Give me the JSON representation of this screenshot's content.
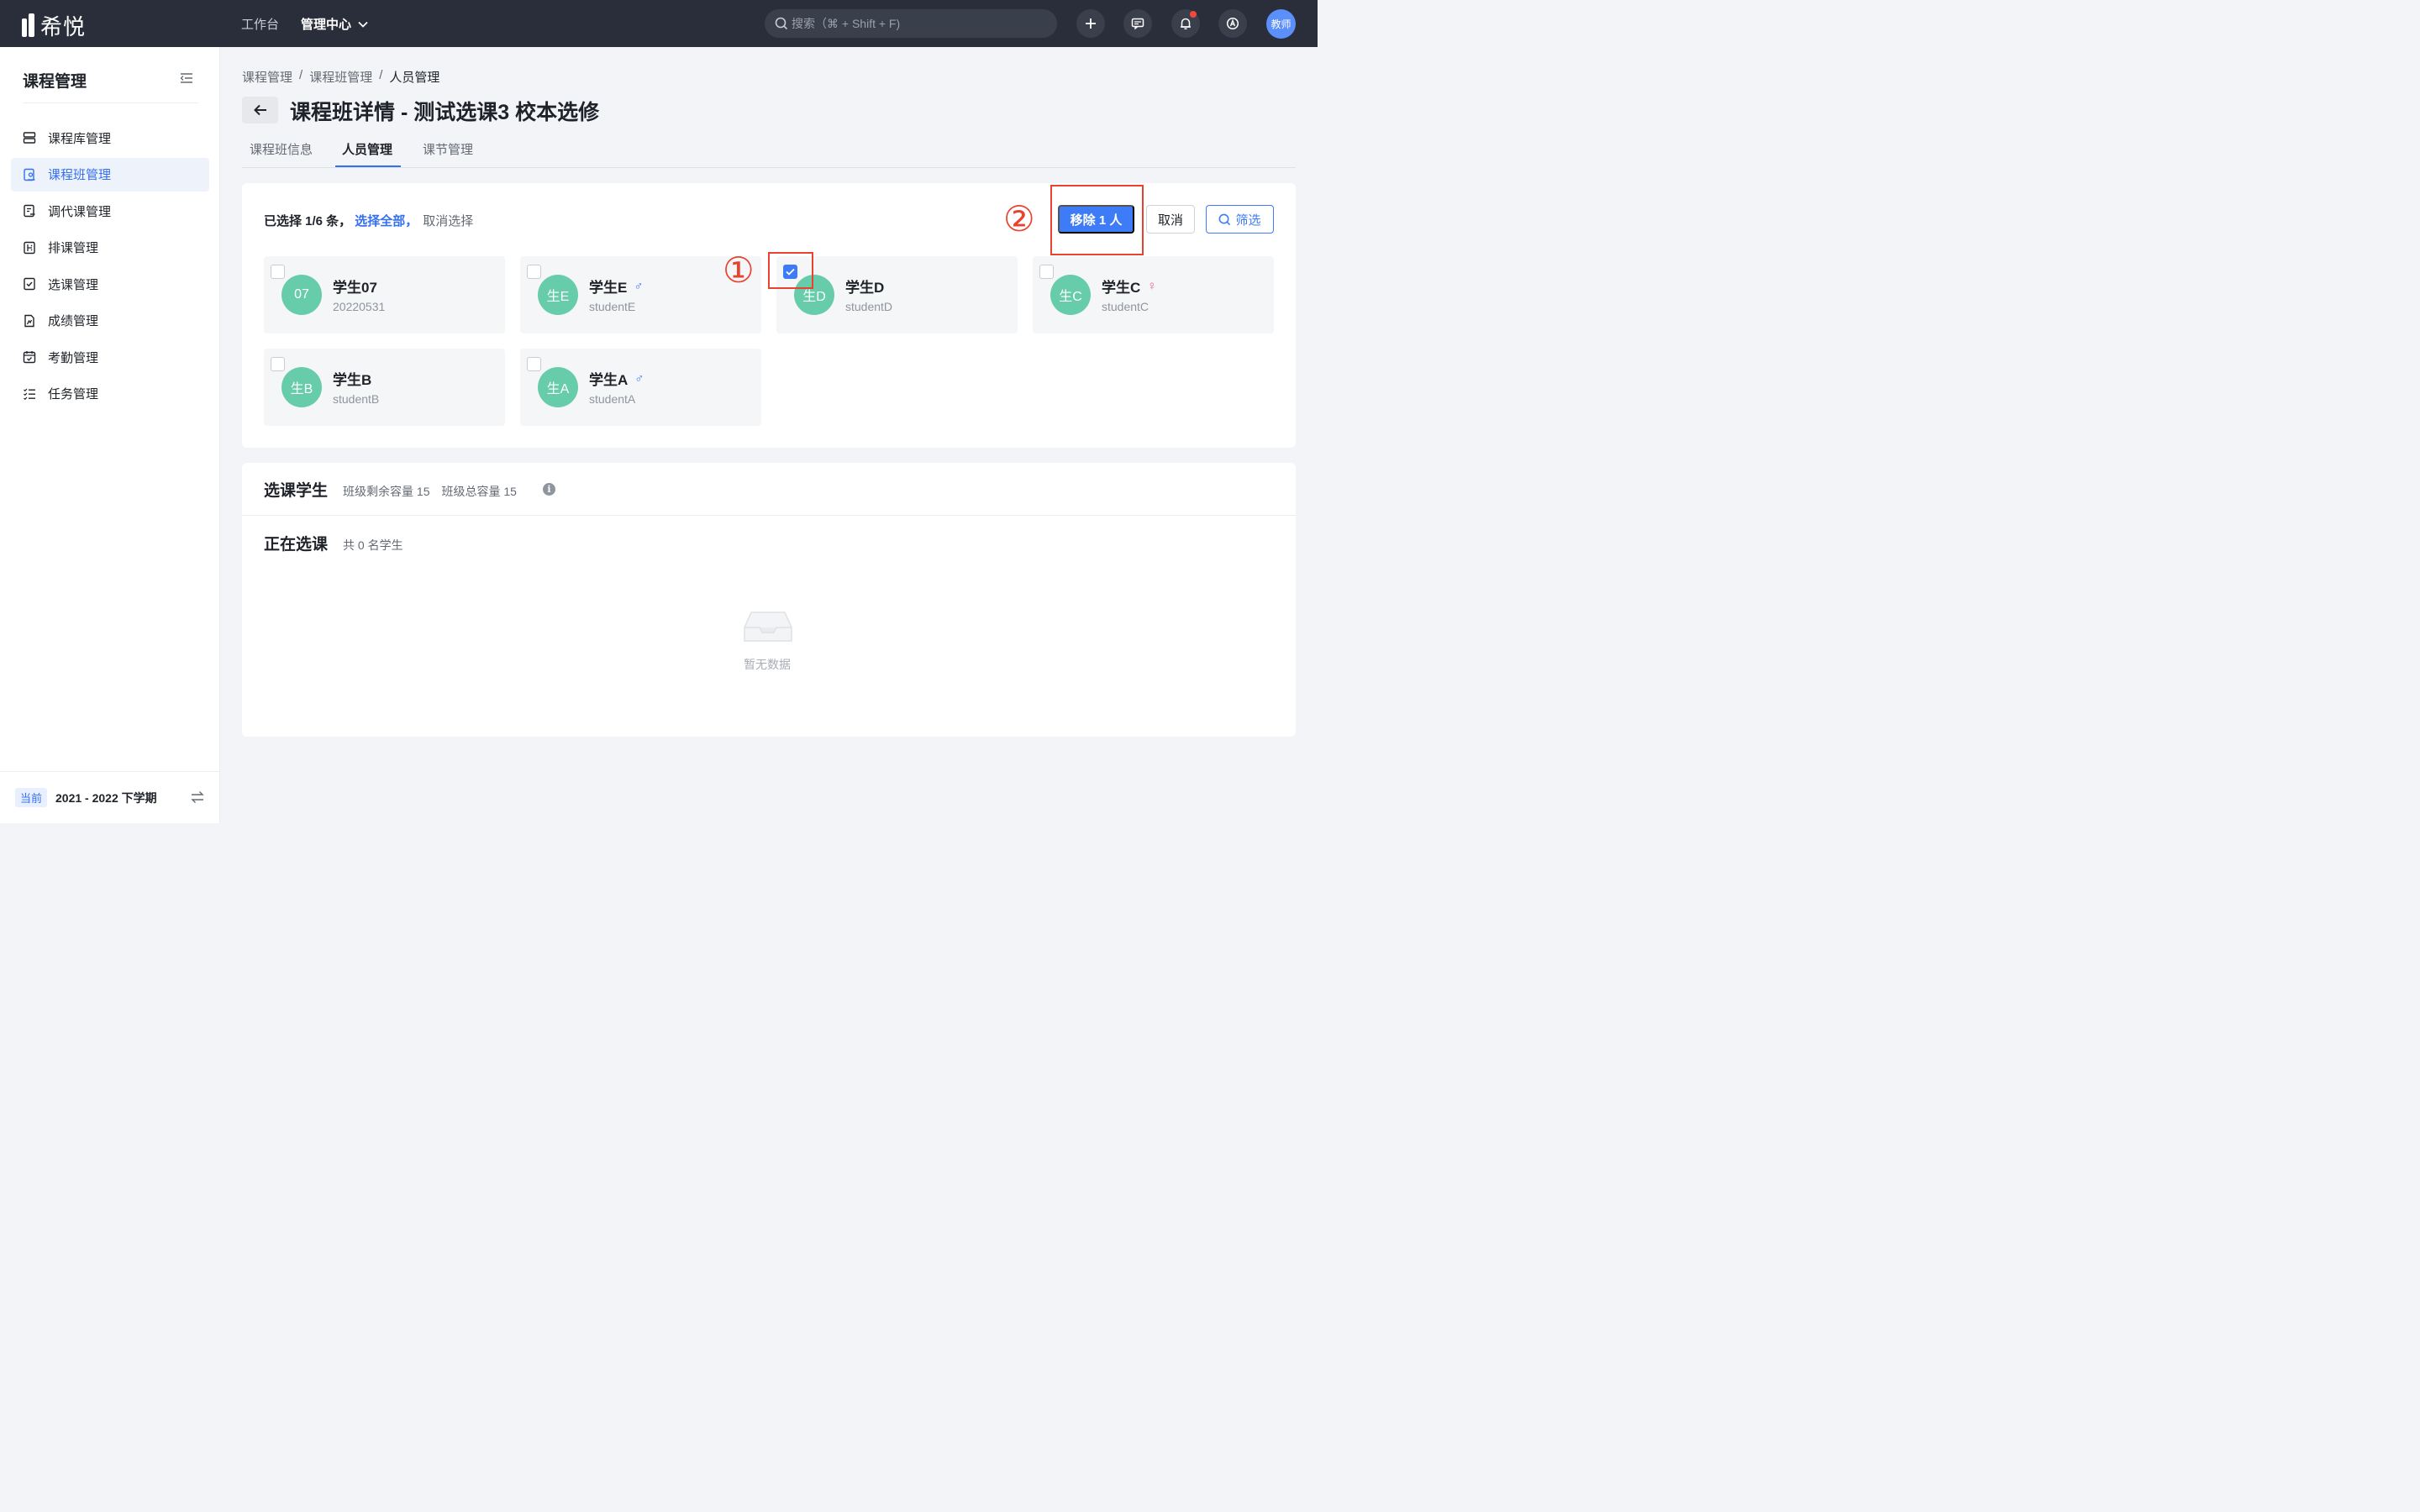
{
  "topbar": {
    "logo_text": "希悦",
    "nav_workbench": "工作台",
    "nav_admin": "管理中心",
    "search_placeholder": "搜索（⌘ + Shift + F)",
    "avatar_text": "教师"
  },
  "sidebar": {
    "title": "课程管理",
    "items": [
      {
        "label": "课程库管理",
        "icon": "course-library-icon"
      },
      {
        "label": "课程班管理",
        "icon": "course-class-icon"
      },
      {
        "label": "调代课管理",
        "icon": "substitute-icon"
      },
      {
        "label": "排课管理",
        "icon": "schedule-icon"
      },
      {
        "label": "选课管理",
        "icon": "selection-icon"
      },
      {
        "label": "成绩管理",
        "icon": "grade-icon"
      },
      {
        "label": "考勤管理",
        "icon": "attendance-icon"
      },
      {
        "label": "任务管理",
        "icon": "task-icon"
      }
    ],
    "footer_tag": "当前",
    "footer_term": "2021 - 2022 下学期"
  },
  "breadcrumb": [
    "课程管理",
    "/",
    "课程班管理",
    "/",
    "人员管理"
  ],
  "page_title": "课程班详情 - 测试选课3 校本选修",
  "tabs": [
    "课程班信息",
    "人员管理",
    "课节管理"
  ],
  "selection": {
    "info": "已选择 1/6 条，",
    "select_all": "选择全部，",
    "cancel_select": "取消选择",
    "remove_button": "移除 1 人",
    "cancel_button": "取消",
    "filter_button": "筛选"
  },
  "annotations": [
    "①",
    "②"
  ],
  "students": [
    {
      "avatar": "07",
      "name": "学生07",
      "id": "20220531",
      "gender": "",
      "checked": false
    },
    {
      "avatar": "生E",
      "name": "学生E",
      "id": "studentE",
      "gender": "♂",
      "checked": false
    },
    {
      "avatar": "生D",
      "name": "学生D",
      "id": "studentD",
      "gender": "",
      "checked": true
    },
    {
      "avatar": "生C",
      "name": "学生C",
      "id": "studentC",
      "gender": "♀",
      "checked": false
    },
    {
      "avatar": "生B",
      "name": "学生B",
      "id": "studentB",
      "gender": "",
      "checked": false
    },
    {
      "avatar": "生A",
      "name": "学生A",
      "id": "studentA",
      "gender": "♂",
      "checked": false
    }
  ],
  "selected_section": {
    "title": "选课学生",
    "remaining": "班级剩余容量 15",
    "total": "班级总容量 15"
  },
  "selecting_section": {
    "title": "正在选课",
    "count": "共 0 名学生",
    "empty_text": "暂无数据"
  },
  "colors": {
    "accent": "#3e7bf7",
    "topbar": "#2a2e3a",
    "avatar_green": "#66ccaa",
    "annotation_red": "#e8432e"
  }
}
